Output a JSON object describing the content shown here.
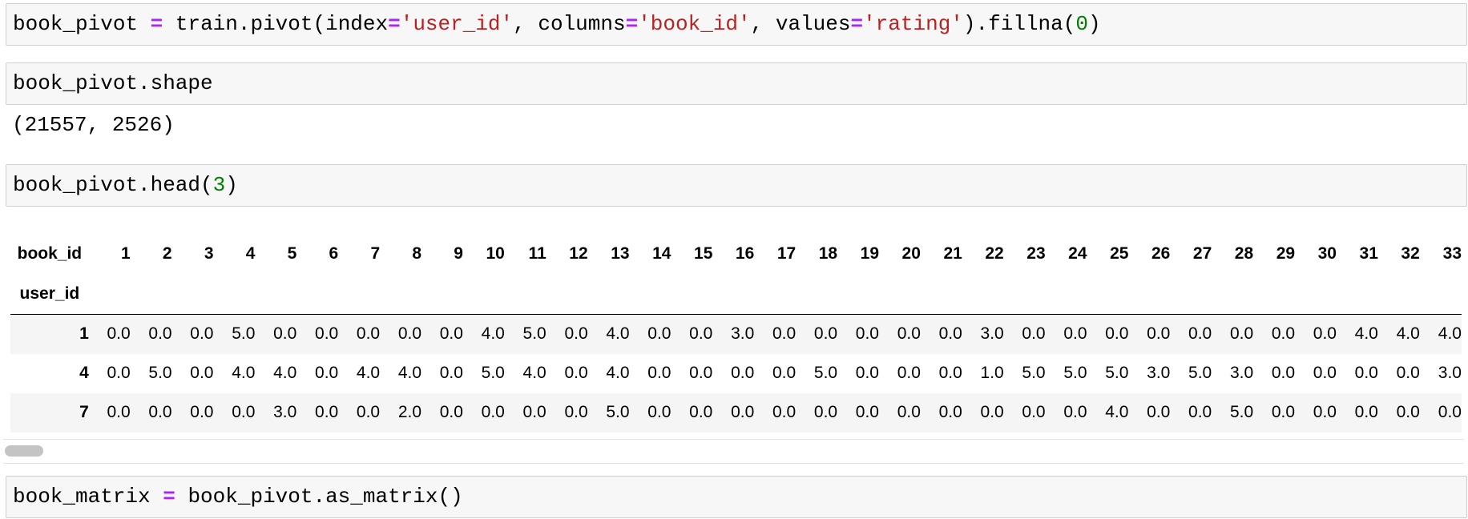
{
  "cells": [
    {
      "name": "pivot",
      "tokens": [
        "book_pivot ",
        "= ",
        "train.pivot(index",
        "=",
        "'user_id'",
        ", columns",
        "=",
        "'book_id'",
        ", values",
        "=",
        "'rating'",
        ").fillna(",
        "0",
        ")"
      ]
    },
    {
      "name": "shape",
      "tokens": [
        "book_pivot.shape"
      ]
    },
    {
      "name": "head",
      "tokens": [
        "book_pivot.head(",
        "3",
        ")"
      ]
    },
    {
      "name": "matrix",
      "tokens": [
        "book_matrix ",
        "= ",
        "book_pivot.as_matrix()"
      ]
    }
  ],
  "shape_output": "(21557, 2526)",
  "dataframe": {
    "columns_name": "book_id",
    "index_name": "user_id",
    "columns": [
      "1",
      "2",
      "3",
      "4",
      "5",
      "6",
      "7",
      "8",
      "9",
      "10",
      "11",
      "12",
      "13",
      "14",
      "15",
      "16",
      "17",
      "18",
      "19",
      "20",
      "21",
      "22",
      "23",
      "24",
      "25",
      "26",
      "27",
      "28",
      "29",
      "30",
      "31",
      "32",
      "33"
    ],
    "rows": [
      {
        "index": "1",
        "values": [
          "0.0",
          "0.0",
          "0.0",
          "5.0",
          "0.0",
          "0.0",
          "0.0",
          "0.0",
          "0.0",
          "4.0",
          "5.0",
          "0.0",
          "4.0",
          "0.0",
          "0.0",
          "3.0",
          "0.0",
          "0.0",
          "0.0",
          "0.0",
          "0.0",
          "3.0",
          "0.0",
          "0.0",
          "0.0",
          "0.0",
          "0.0",
          "0.0",
          "0.0",
          "0.0",
          "4.0",
          "4.0",
          "4.0"
        ]
      },
      {
        "index": "4",
        "values": [
          "0.0",
          "5.0",
          "0.0",
          "4.0",
          "4.0",
          "0.0",
          "4.0",
          "4.0",
          "0.0",
          "5.0",
          "4.0",
          "0.0",
          "4.0",
          "0.0",
          "0.0",
          "0.0",
          "0.0",
          "5.0",
          "0.0",
          "0.0",
          "0.0",
          "1.0",
          "5.0",
          "5.0",
          "5.0",
          "3.0",
          "5.0",
          "3.0",
          "0.0",
          "0.0",
          "0.0",
          "0.0",
          "3.0"
        ]
      },
      {
        "index": "7",
        "values": [
          "0.0",
          "0.0",
          "0.0",
          "0.0",
          "3.0",
          "0.0",
          "0.0",
          "2.0",
          "0.0",
          "0.0",
          "0.0",
          "0.0",
          "5.0",
          "0.0",
          "0.0",
          "0.0",
          "0.0",
          "0.0",
          "0.0",
          "0.0",
          "0.0",
          "0.0",
          "0.0",
          "0.0",
          "4.0",
          "0.0",
          "0.0",
          "5.0",
          "0.0",
          "0.0",
          "0.0",
          "0.0",
          "0.0"
        ]
      }
    ]
  },
  "colors": {
    "operator": "#aa22ff",
    "string": "#ba2121",
    "number": "#008000",
    "cell_bg": "#f7f7f7"
  }
}
